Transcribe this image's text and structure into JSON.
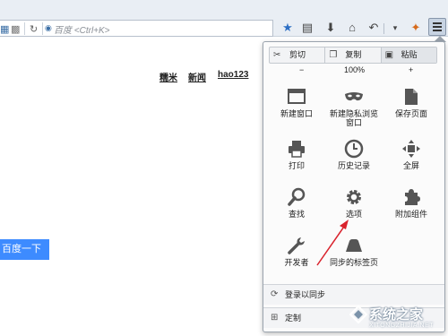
{
  "toolbar": {
    "search_placeholder": "百度 <Ctrl+K>",
    "icons": [
      "qr-code-icon",
      "reload-icon",
      "star-icon",
      "reading-list-icon",
      "download-icon",
      "home-icon",
      "back-icon",
      "dropdown-icon",
      "addon-icon",
      "menu-icon"
    ]
  },
  "page": {
    "nav_links": [
      "糯米",
      "新闻",
      "hao123"
    ],
    "search_button": "百度一下"
  },
  "menu": {
    "edit": {
      "cut": "剪切",
      "copy": "复制",
      "paste": "粘贴"
    },
    "zoom": {
      "minus": "−",
      "level": "100%",
      "plus": "+"
    },
    "items": [
      {
        "label": "新建窗口",
        "icon": "new-window-icon"
      },
      {
        "label": "新建隐私浏览窗口",
        "label_line1": "新建隐私浏览",
        "label_line2": "窗口",
        "icon": "private-mask-icon"
      },
      {
        "label": "保存页面",
        "icon": "save-page-icon"
      },
      {
        "label": "打印",
        "icon": "print-icon"
      },
      {
        "label": "历史记录",
        "icon": "history-clock-icon"
      },
      {
        "label": "全屏",
        "icon": "fullscreen-icon"
      },
      {
        "label": "查找",
        "icon": "find-magnifier-icon"
      },
      {
        "label": "选项",
        "icon": "options-gear-icon"
      },
      {
        "label": "附加组件",
        "icon": "addons-puzzle-icon"
      },
      {
        "label": "开发者",
        "icon": "developer-wrench-icon"
      },
      {
        "label": "同步的标签页",
        "icon": "synced-tabs-icon"
      }
    ],
    "signin": "登录以同步",
    "customize": "定制"
  },
  "watermark": {
    "title": "系统之家",
    "url": "XITONGZHIJIA.NET"
  },
  "colors": {
    "accent": "#3d8bff",
    "annotation": "#d9232d",
    "panel_bg": "#fbfbfb"
  }
}
